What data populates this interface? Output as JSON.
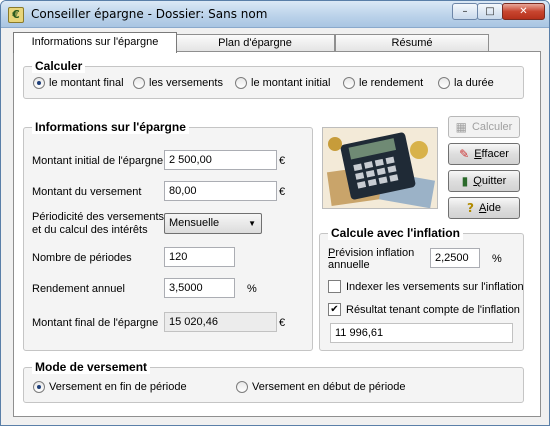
{
  "window": {
    "title": "Conseiller épargne - Dossier: Sans nom",
    "app_icon": "piggy-bank-icon",
    "controls": {
      "minimize": "–",
      "maximize": "□",
      "close": "✕"
    }
  },
  "tabs": [
    {
      "label": "Informations sur l'épargne",
      "active": true
    },
    {
      "label": "Plan d'épargne",
      "active": false
    },
    {
      "label": "Résumé",
      "active": false
    }
  ],
  "calculer": {
    "title": "Calculer",
    "options": [
      {
        "label": "le montant final",
        "selected": true
      },
      {
        "label": "les versements",
        "selected": false
      },
      {
        "label": "le montant initial",
        "selected": false
      },
      {
        "label": "le rendement",
        "selected": false
      },
      {
        "label": "la durée",
        "selected": false
      }
    ]
  },
  "info": {
    "title": "Informations sur l'épargne",
    "montant_initial": {
      "label": "Montant initial de l'épargne",
      "value": "2 500,00",
      "unit": "€"
    },
    "montant_versement": {
      "label": "Montant du versement",
      "value": "80,00",
      "unit": "€"
    },
    "periodicite": {
      "label_line1": "Périodicité des versements",
      "label_line2": "et du calcul des intérêts",
      "value": "Mensuelle"
    },
    "nombre_periodes": {
      "label": "Nombre de périodes",
      "value": "120"
    },
    "rendement": {
      "label": "Rendement annuel",
      "value": "3,5000",
      "unit": "%"
    },
    "montant_final": {
      "label": "Montant final de l'épargne",
      "value": "15 020,46",
      "unit": "€"
    }
  },
  "buttons": {
    "calculer": "Calculer",
    "effacer": "Effacer",
    "quitter": "Quitter",
    "aide": "Aide"
  },
  "inflation": {
    "title": "Calcule avec l'inflation",
    "prevision_label_line1": "Prévision inflation",
    "prevision_label_line2": "annuelle",
    "prevision_value": "2,2500",
    "prevision_unit": "%",
    "indexer": {
      "label": "Indexer les versements sur l'inflation",
      "checked": false
    },
    "resultat": {
      "label": "Résultat tenant compte de l'inflation",
      "checked": true
    },
    "result_value": "11 996,61"
  },
  "mode": {
    "title": "Mode de versement",
    "options": [
      {
        "label": "Versement en fin de période",
        "selected": true
      },
      {
        "label": "Versement en début de période",
        "selected": false
      }
    ]
  }
}
